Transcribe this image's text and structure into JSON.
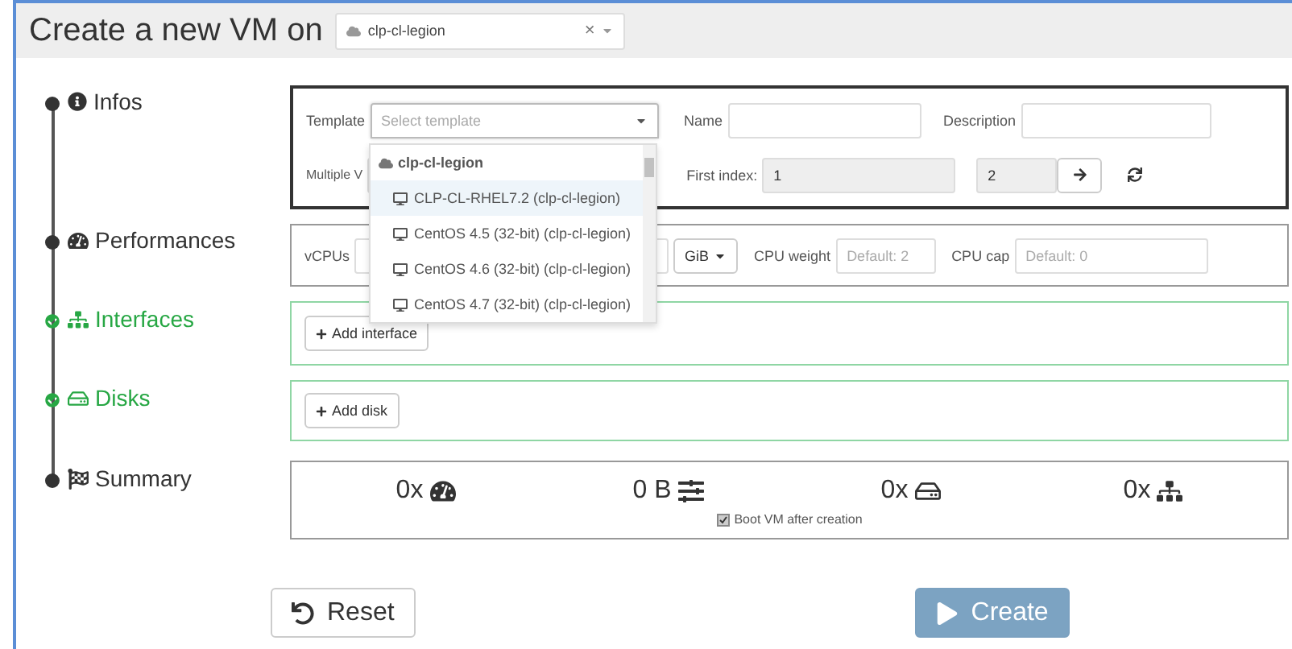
{
  "header": {
    "title": "Create a new VM on",
    "host_select": {
      "value": "clp-cl-legion",
      "clear": "×"
    }
  },
  "steps": [
    {
      "label": "Infos",
      "done": false
    },
    {
      "label": "Performances",
      "done": false
    },
    {
      "label": "Interfaces",
      "done": true
    },
    {
      "label": "Disks",
      "done": true
    },
    {
      "label": "Summary",
      "done": false
    }
  ],
  "infos": {
    "template": {
      "label": "Template",
      "placeholder": "Select template",
      "open": true,
      "group": "clp-cl-legion",
      "options": [
        {
          "label": "CLP-CL-RHEL7.2 (clp-cl-legion)",
          "selected": true
        },
        {
          "label": "CentOS 4.5 (32-bit) (clp-cl-legion)",
          "selected": false
        },
        {
          "label": "CentOS 4.6 (32-bit) (clp-cl-legion)",
          "selected": false
        },
        {
          "label": "CentOS 4.7 (32-bit) (clp-cl-legion)",
          "selected": false
        }
      ]
    },
    "name": {
      "label": "Name"
    },
    "description": {
      "label": "Description"
    },
    "multiple_label": "Multiple V",
    "first_index": {
      "label": "First index:",
      "value": "1"
    },
    "last_index": {
      "value": "2"
    }
  },
  "performances": {
    "vcpus_label": "vCPUs",
    "memory_unit": "GiB",
    "cpu_weight": {
      "label": "CPU weight",
      "placeholder": "Default: 2"
    },
    "cpu_cap": {
      "label": "CPU cap",
      "placeholder": "Default: 0"
    }
  },
  "interfaces": {
    "add_button": "Add interface"
  },
  "disks": {
    "add_button": "Add disk"
  },
  "summary": {
    "items": [
      {
        "kind": "cpus",
        "value": "0x"
      },
      {
        "kind": "memory",
        "value": "0 B"
      },
      {
        "kind": "disks",
        "value": "0x"
      },
      {
        "kind": "interfaces",
        "value": "0x"
      }
    ],
    "boot": {
      "label": "Boot VM after creation",
      "checked": true
    }
  },
  "actions": {
    "reset": "Reset",
    "create": {
      "label": "Create",
      "disabled": true
    }
  }
}
